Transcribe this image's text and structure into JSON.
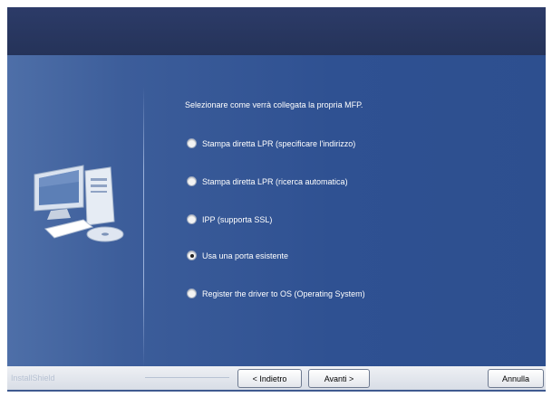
{
  "prompt": "Selezionare come verrà collegata la propria MFP.",
  "options": [
    {
      "label": "Stampa diretta LPR (specificare l'indirizzo)",
      "checked": false
    },
    {
      "label": "Stampa diretta LPR (ricerca automatica)",
      "checked": false
    },
    {
      "label": "IPP (supporta SSL)",
      "checked": false
    },
    {
      "label": "Usa una porta esistente",
      "checked": true
    },
    {
      "label": "Register the driver to OS (Operating System)",
      "checked": false
    }
  ],
  "footer": {
    "brand": "InstallShield",
    "back_label": "< Indietro",
    "next_label": "Avanti >",
    "cancel_label": "Annulla"
  },
  "colors": {
    "header": "#2a3963",
    "panel": "#2f5192",
    "text": "#ffffff"
  },
  "icons": {
    "illustration": "computer-with-cd-icon"
  }
}
